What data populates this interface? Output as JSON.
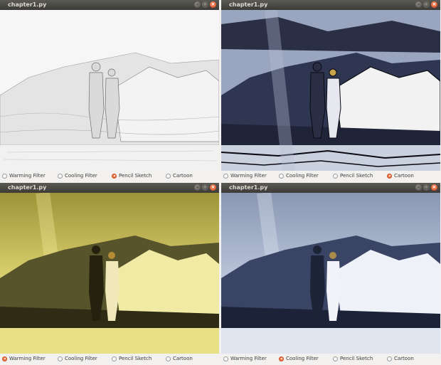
{
  "windows": [
    {
      "title": "chapter1.py",
      "filter": "Pencil Sketch",
      "radios": [
        "Warming Filter",
        "Cooling Filter",
        "Pencil Sketch",
        "Cartoon"
      ],
      "selected_index": 2,
      "palette": {
        "sky": "#f4f4f4",
        "mountain": "#d9d9d9",
        "snow": "#ececec",
        "people": "#b8b8b8",
        "ink": "#7c7c7c"
      }
    },
    {
      "title": "chapter1.py",
      "filter": "Cartoon",
      "radios": [
        "Warming Filter",
        "Cooling Filter",
        "Pencil Sketch",
        "Cartoon"
      ],
      "selected_index": 3,
      "palette": {
        "sky": "#a5b0c8",
        "mountain": "#2f3652",
        "snow": "#c9d0de",
        "people": "#2a2e45",
        "ink": "#0a0a12"
      }
    },
    {
      "title": "chapter1.py",
      "filter": "Warming Filter",
      "radios": [
        "Warming Filter",
        "Cooling Filter",
        "Pencil Sketch",
        "Cartoon"
      ],
      "selected_index": 0,
      "palette": {
        "sky": "#c8bc4f",
        "mountain": "#3d3b1c",
        "snow": "#e9e18c",
        "people": "#2c2a16",
        "ink": "#1a1a0c"
      }
    },
    {
      "title": "chapter1.py",
      "filter": "Cooling Filter",
      "radios": [
        "Warming Filter",
        "Cooling Filter",
        "Pencil Sketch",
        "Cartoon"
      ],
      "selected_index": 1,
      "palette": {
        "sky": "#a7b4cd",
        "mountain": "#283352",
        "snow": "#dfe5ef",
        "people": "#222a40",
        "ink": "#141a2a"
      }
    }
  ]
}
